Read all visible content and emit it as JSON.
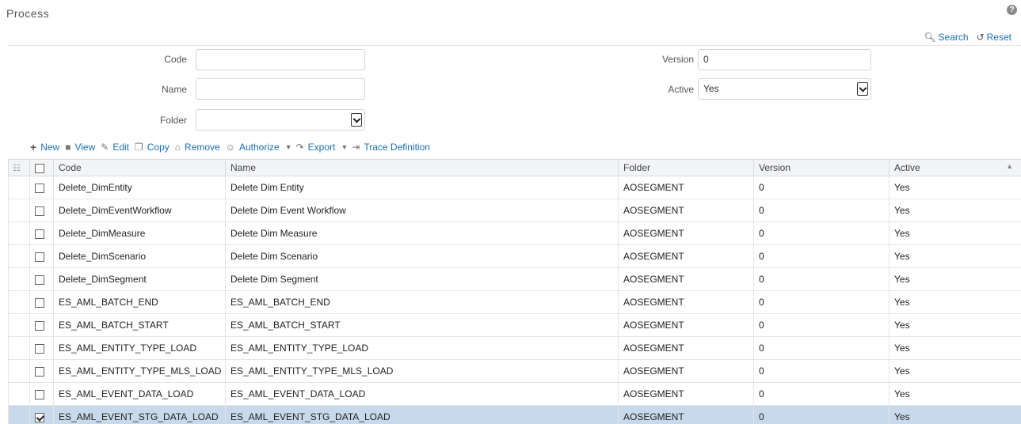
{
  "page": {
    "title": "Process",
    "help": "?"
  },
  "search": {
    "search_label": "Search",
    "reset_label": "Reset"
  },
  "form": {
    "code_label": "Code",
    "code_value": "",
    "name_label": "Name",
    "name_value": "",
    "folder_label": "Folder",
    "folder_value": "",
    "version_label": "Version",
    "version_value": "0",
    "active_label": "Active",
    "active_value": "Yes"
  },
  "toolbar": {
    "new_label": "New",
    "view_label": "View",
    "edit_label": "Edit",
    "copy_label": "Copy",
    "remove_label": "Remove",
    "authorize_label": "Authorize",
    "export_label": "Export",
    "trace_label": "Trace Definition"
  },
  "table": {
    "columns": [
      "Code",
      "Name",
      "Folder",
      "Version",
      "Active"
    ],
    "rows": [
      {
        "code": "Delete_DimEntity",
        "name": "Delete Dim Entity",
        "folder": "AOSEGMENT",
        "version": "0",
        "active": "Yes",
        "checked": false
      },
      {
        "code": "Delete_DimEventWorkflow",
        "name": "Delete Dim Event Workflow",
        "folder": "AOSEGMENT",
        "version": "0",
        "active": "Yes",
        "checked": false
      },
      {
        "code": "Delete_DimMeasure",
        "name": "Delete Dim Measure",
        "folder": "AOSEGMENT",
        "version": "0",
        "active": "Yes",
        "checked": false
      },
      {
        "code": "Delete_DimScenario",
        "name": "Delete Dim Scenario",
        "folder": "AOSEGMENT",
        "version": "0",
        "active": "Yes",
        "checked": false
      },
      {
        "code": "Delete_DimSegment",
        "name": "Delete Dim Segment",
        "folder": "AOSEGMENT",
        "version": "0",
        "active": "Yes",
        "checked": false
      },
      {
        "code": "ES_AML_BATCH_END",
        "name": "ES_AML_BATCH_END",
        "folder": "AOSEGMENT",
        "version": "0",
        "active": "Yes",
        "checked": false
      },
      {
        "code": "ES_AML_BATCH_START",
        "name": "ES_AML_BATCH_START",
        "folder": "AOSEGMENT",
        "version": "0",
        "active": "Yes",
        "checked": false
      },
      {
        "code": "ES_AML_ENTITY_TYPE_LOAD",
        "name": "ES_AML_ENTITY_TYPE_LOAD",
        "folder": "AOSEGMENT",
        "version": "0",
        "active": "Yes",
        "checked": false
      },
      {
        "code": "ES_AML_ENTITY_TYPE_MLS_LOAD",
        "name": "ES_AML_ENTITY_TYPE_MLS_LOAD",
        "folder": "AOSEGMENT",
        "version": "0",
        "active": "Yes",
        "checked": false
      },
      {
        "code": "ES_AML_EVENT_DATA_LOAD",
        "name": "ES_AML_EVENT_DATA_LOAD",
        "folder": "AOSEGMENT",
        "version": "0",
        "active": "Yes",
        "checked": false
      },
      {
        "code": "ES_AML_EVENT_STG_DATA_LOAD",
        "name": "ES_AML_EVENT_STG_DATA_LOAD",
        "folder": "AOSEGMENT",
        "version": "0",
        "active": "Yes",
        "checked": true
      }
    ]
  }
}
